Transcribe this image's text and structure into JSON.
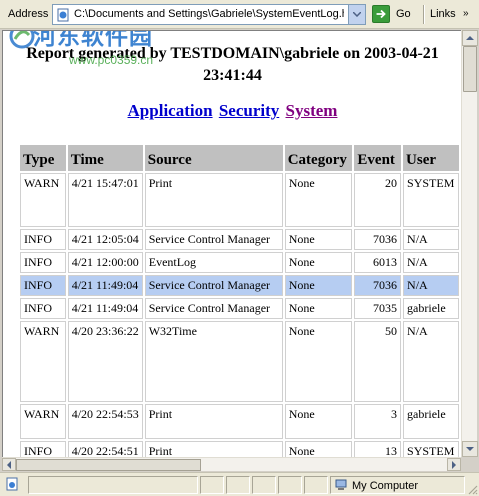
{
  "address_bar": {
    "label": "Address",
    "url": "C:\\Documents and Settings\\Gabriele\\SystemEventLog.ht",
    "go_label": "Go",
    "links_label": "Links",
    "links_chevron": "»"
  },
  "watermark": {
    "text": "河东软件园",
    "url": "www.pc0359.cn"
  },
  "report": {
    "title_line1": "Report generated by TESTDOMAIN\\gabriele on 2003-04-21",
    "title_line2": "23:41:44"
  },
  "tabs": [
    {
      "label": "Application",
      "state": "link"
    },
    {
      "label": "Security",
      "state": "link"
    },
    {
      "label": "System",
      "state": "visited"
    }
  ],
  "table": {
    "headers": [
      "Type",
      "Time",
      "Source",
      "Category",
      "Event",
      "User"
    ],
    "rows": [
      {
        "type": "WARN",
        "time": "4/21 15:47:01",
        "source": "Print",
        "category": "None",
        "event": "20",
        "user": "SYSTEM",
        "tall": true
      },
      {
        "type": "INFO",
        "time": "4/21 12:05:04",
        "source": "Service Control Manager",
        "category": "None",
        "event": "7036",
        "user": "N/A"
      },
      {
        "type": "INFO",
        "time": "4/21 12:00:00",
        "source": "EventLog",
        "category": "None",
        "event": "6013",
        "user": "N/A"
      },
      {
        "type": "INFO",
        "time": "4/21 11:49:04",
        "source": "Service Control Manager",
        "category": "None",
        "event": "7036",
        "user": "N/A",
        "selected": true
      },
      {
        "type": "INFO",
        "time": "4/21 11:49:04",
        "source": "Service Control Manager",
        "category": "None",
        "event": "7035",
        "user": "gabriele"
      },
      {
        "type": "WARN",
        "time": "4/20 23:36:22",
        "source": "W32Time",
        "category": "None",
        "event": "50",
        "user": "N/A",
        "xtall": true
      },
      {
        "type": "WARN",
        "time": "4/20 22:54:53",
        "source": "Print",
        "category": "None",
        "event": "3",
        "user": "gabriele",
        "tall": true
      },
      {
        "type": "INFO",
        "time": "4/20 22:54:51",
        "source": "Print",
        "category": "None",
        "event": "13",
        "user": "SYSTEM"
      }
    ]
  },
  "status_bar": {
    "zone": "My Computer"
  },
  "colors": {
    "selected_row": "#b6cdf2",
    "header_bg": "#c0c0c0",
    "link": "#0000cc",
    "visited": "#800080"
  }
}
